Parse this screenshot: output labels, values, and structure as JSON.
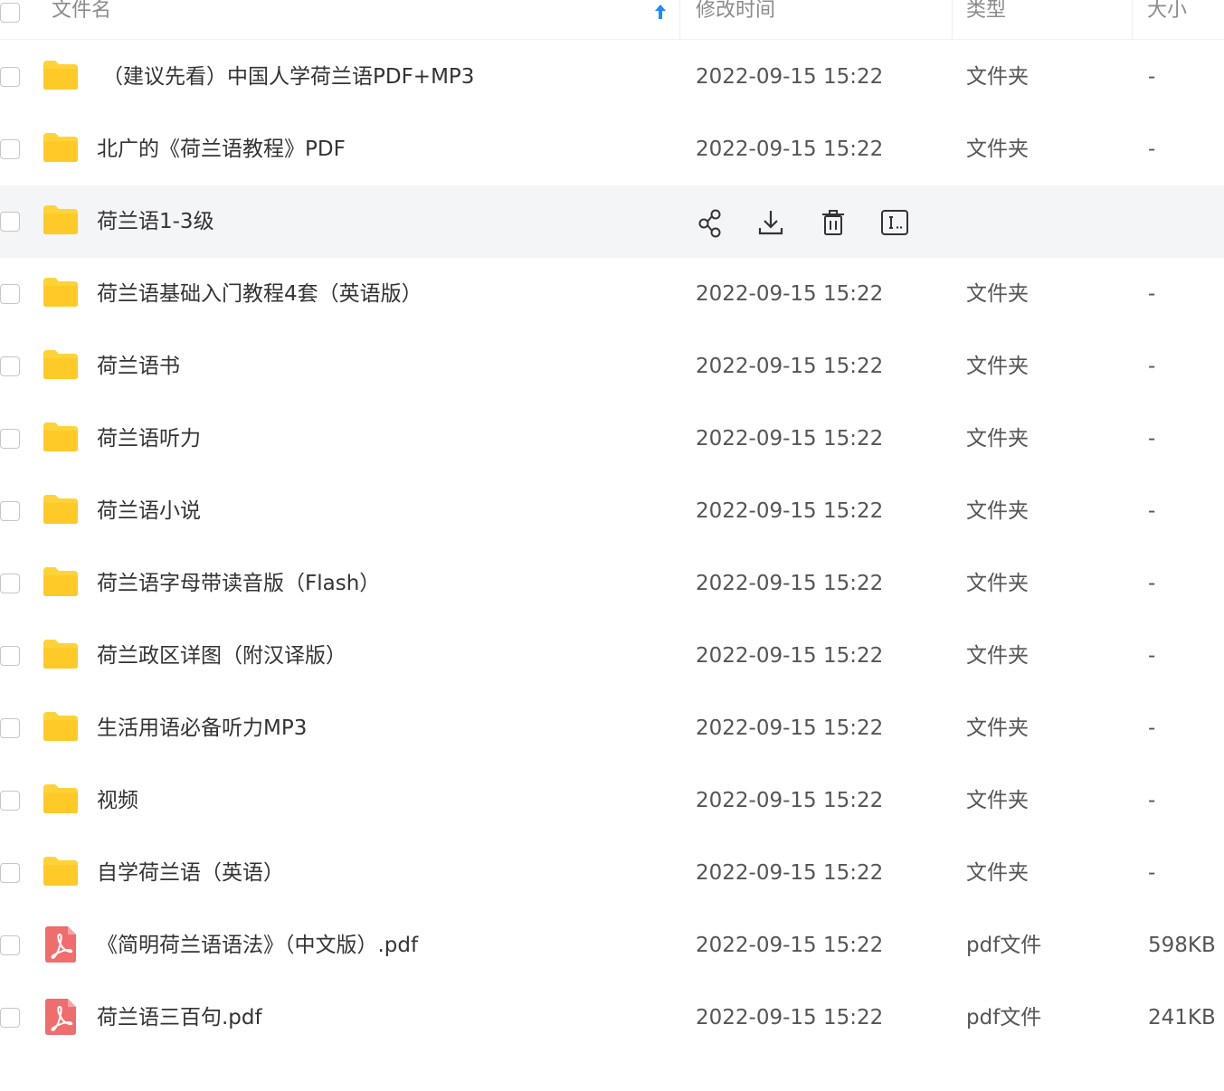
{
  "header": {
    "name_label": "文件名",
    "time_label": "修改时间",
    "type_label": "类型",
    "size_label": "大小",
    "sort_icon": "arrow-up-icon"
  },
  "rows": [
    {
      "name": "（建议先看）中国人学荷兰语PDF+MP3",
      "time": "2022-09-15 15:22",
      "type": "文件夹",
      "size": "-",
      "icon": "folder-icon"
    },
    {
      "name": "北广的《荷兰语教程》PDF",
      "time": "2022-09-15 15:22",
      "type": "文件夹",
      "size": "-",
      "icon": "folder-icon"
    },
    {
      "name": "荷兰语1-3级",
      "time": "",
      "type": "",
      "size": "",
      "icon": "folder-icon"
    },
    {
      "name": "荷兰语基础入门教程4套（英语版）",
      "time": "2022-09-15 15:22",
      "type": "文件夹",
      "size": "-",
      "icon": "folder-icon"
    },
    {
      "name": "荷兰语书",
      "time": "2022-09-15 15:22",
      "type": "文件夹",
      "size": "-",
      "icon": "folder-icon"
    },
    {
      "name": "荷兰语听力",
      "time": "2022-09-15 15:22",
      "type": "文件夹",
      "size": "-",
      "icon": "folder-icon"
    },
    {
      "name": "荷兰语小说",
      "time": "2022-09-15 15:22",
      "type": "文件夹",
      "size": "-",
      "icon": "folder-icon"
    },
    {
      "name": "荷兰语字母带读音版（Flash）",
      "time": "2022-09-15 15:22",
      "type": "文件夹",
      "size": "-",
      "icon": "folder-icon"
    },
    {
      "name": "荷兰政区详图（附汉译版）",
      "time": "2022-09-15 15:22",
      "type": "文件夹",
      "size": "-",
      "icon": "folder-icon"
    },
    {
      "name": "生活用语必备听力MP3",
      "time": "2022-09-15 15:22",
      "type": "文件夹",
      "size": "-",
      "icon": "folder-icon"
    },
    {
      "name": "视频",
      "time": "2022-09-15 15:22",
      "type": "文件夹",
      "size": "-",
      "icon": "folder-icon"
    },
    {
      "name": "自学荷兰语（英语）",
      "time": "2022-09-15 15:22",
      "type": "文件夹",
      "size": "-",
      "icon": "folder-icon"
    },
    {
      "name": "《简明荷兰语语法》（中文版）.pdf",
      "time": "2022-09-15 15:22",
      "type": "pdf文件",
      "size": "598KB",
      "icon": "pdf-icon"
    },
    {
      "name": "荷兰语三百句.pdf",
      "time": "2022-09-15 15:22",
      "type": "pdf文件",
      "size": "241KB",
      "icon": "pdf-icon"
    }
  ],
  "hover_actions": [
    {
      "icon": "share-icon"
    },
    {
      "icon": "download-icon"
    },
    {
      "icon": "delete-icon"
    },
    {
      "icon": "rename-icon"
    }
  ],
  "colors": {
    "folder": "#ffd338",
    "pdf": "#f06d6d",
    "sort_arrow": "#1a8cff",
    "hover_row": "#f4f5f7"
  }
}
